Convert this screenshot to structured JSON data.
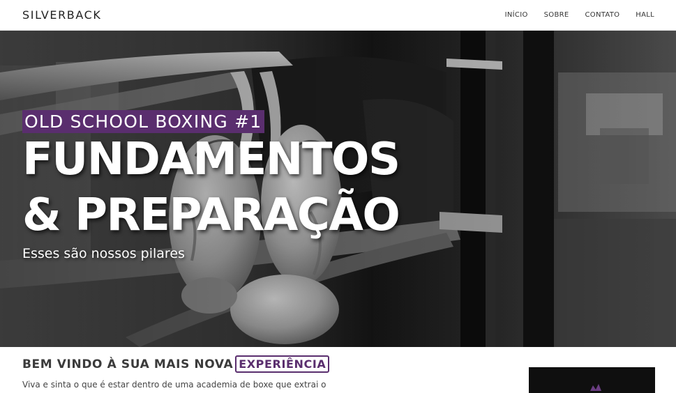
{
  "nav": {
    "brand": "SILVERBACK",
    "links": [
      "INÍCIO",
      "SOBRE",
      "CONTATO",
      "HALL"
    ]
  },
  "hero": {
    "kicker": "OLD SCHOOL BOXING #1",
    "title_line1": "FUNDAMENTOS",
    "title_line2": "& PREPARAÇÃO",
    "subtitle": "Esses são nossos pilares"
  },
  "welcome": {
    "heading": "BEM VINDO À SUA MAIS NOVA",
    "highlight": "EXPERIÊNCIA",
    "text": "Viva e sinta o que é estar dentro de uma academia de boxe que extrai o máximo de"
  },
  "colors": {
    "accent": "#5a2e6e",
    "hero_text": "#ffffff",
    "nav_text": "#333333"
  }
}
